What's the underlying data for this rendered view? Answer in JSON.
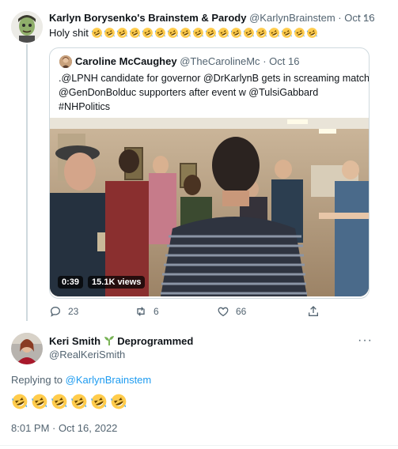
{
  "tweet": {
    "author_name": "Karlyn Borysenko's Brainstem & Parody",
    "author_handle": "@KarlynBrainstem",
    "separator": "·",
    "date": "Oct 16",
    "text": "Holy shit",
    "emoji_name": "rolling-on-the-floor-laughing",
    "emoji_count": 18
  },
  "quote": {
    "author_name": "Caroline McCaughey",
    "author_handle": "@TheCarolineMc",
    "separator": "·",
    "date": "Oct 16",
    "line1": ".@LPNH candidate for governor @DrKarlynB gets in screaming match w",
    "line2": "@GenDonBolduc supporters after event w @TulsiGabbard",
    "line3": "#NHPolitics",
    "video_duration": "0:39",
    "video_views": "15.1K views"
  },
  "actions": {
    "replies": "23",
    "retweets": "6",
    "likes": "66",
    "icons": [
      "reply-icon",
      "retweet-icon",
      "like-icon",
      "share-icon"
    ]
  },
  "reply": {
    "author_name": "Keri Smith",
    "name_suffix": "Deprogrammed",
    "author_handle": "@RealKeriSmith",
    "replying_prefix": "Replying to",
    "replying_to": "@KarlynBrainstem",
    "emoji_count": 6,
    "timestamp": "8:01 PM · Oct 16, 2022"
  },
  "colors": {
    "accent": "#1d9bf0",
    "muted": "#536471",
    "border": "#cfd9de",
    "text": "#0f1419"
  }
}
